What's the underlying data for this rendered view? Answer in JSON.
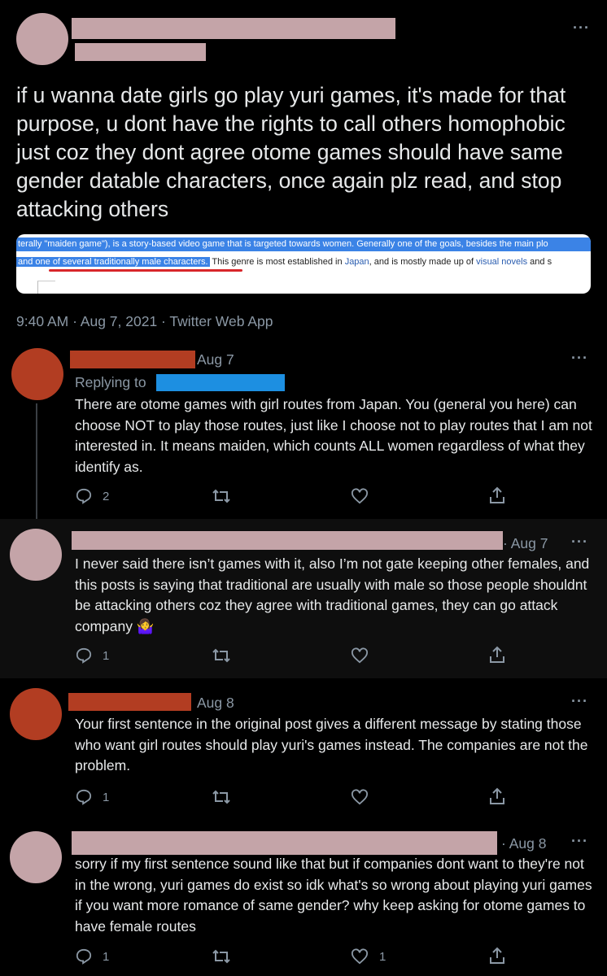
{
  "main_tweet": {
    "more": "···",
    "text": "if u wanna date girls go play yuri games, it's made for that purpose, u dont have the rights to call others homophobic just coz they dont agree otome games should have same gender datable characters, once again plz read, and stop attacking others",
    "embed": {
      "line1": "terally \"maiden game\"), is a story-based video game that is targeted towards women. Generally one of the goals, besides the main plo",
      "line2_highlight": "and one of several traditionally male characters.",
      "line2_rest": " This genre is most established in ",
      "line2_link1": "Japan",
      "line2_mid": ", and is mostly made up of ",
      "line2_link2": "visual novels",
      "line2_end": " and s"
    },
    "timestamp": "9:40 AM · Aug 7, 2021 · Twitter Web App"
  },
  "replies": [
    {
      "date": "Aug 7",
      "replying_to": "Replying to",
      "text": "There are otome games with girl routes from Japan.  You (general you here) can choose NOT to play those routes, just like I choose not to play routes that I am not interested in.  It means maiden, which counts ALL women regardless of what they identify as.",
      "reply_count": "2",
      "like_count": ""
    },
    {
      "date": "· Aug 7",
      "text": "I never said there isn’t games with it, also I’m not gate keeping other females, and this posts is saying that traditional are usually with male so those people shouldnt be attacking others coz they agree with traditional games, they can go attack company 🤷‍♀️",
      "reply_count": "1",
      "like_count": ""
    },
    {
      "date": "Aug 8",
      "text": "Your first sentence in the original post gives a different message by stating those who want girl routes should play yuri's games instead.  The companies are not the problem.",
      "reply_count": "1",
      "like_count": ""
    },
    {
      "date": "· Aug 8",
      "text": "sorry if my first sentence sound like that but if companies dont want to they're not in the wrong, yuri games do exist so idk what's so wrong about playing yuri games if you want more romance of same gender? why keep asking for otome games to have female routes",
      "reply_count": "1",
      "like_count": "1"
    }
  ],
  "colors": {
    "redact_pink": "#c4a4a8",
    "redact_rust": "#b23d22",
    "redact_blue": "#1d8fe1",
    "text": "#e7e9ea",
    "muted": "#8b98a5"
  },
  "icons": [
    "reply-icon",
    "retweet-icon",
    "like-icon",
    "share-icon",
    "more-icon"
  ]
}
